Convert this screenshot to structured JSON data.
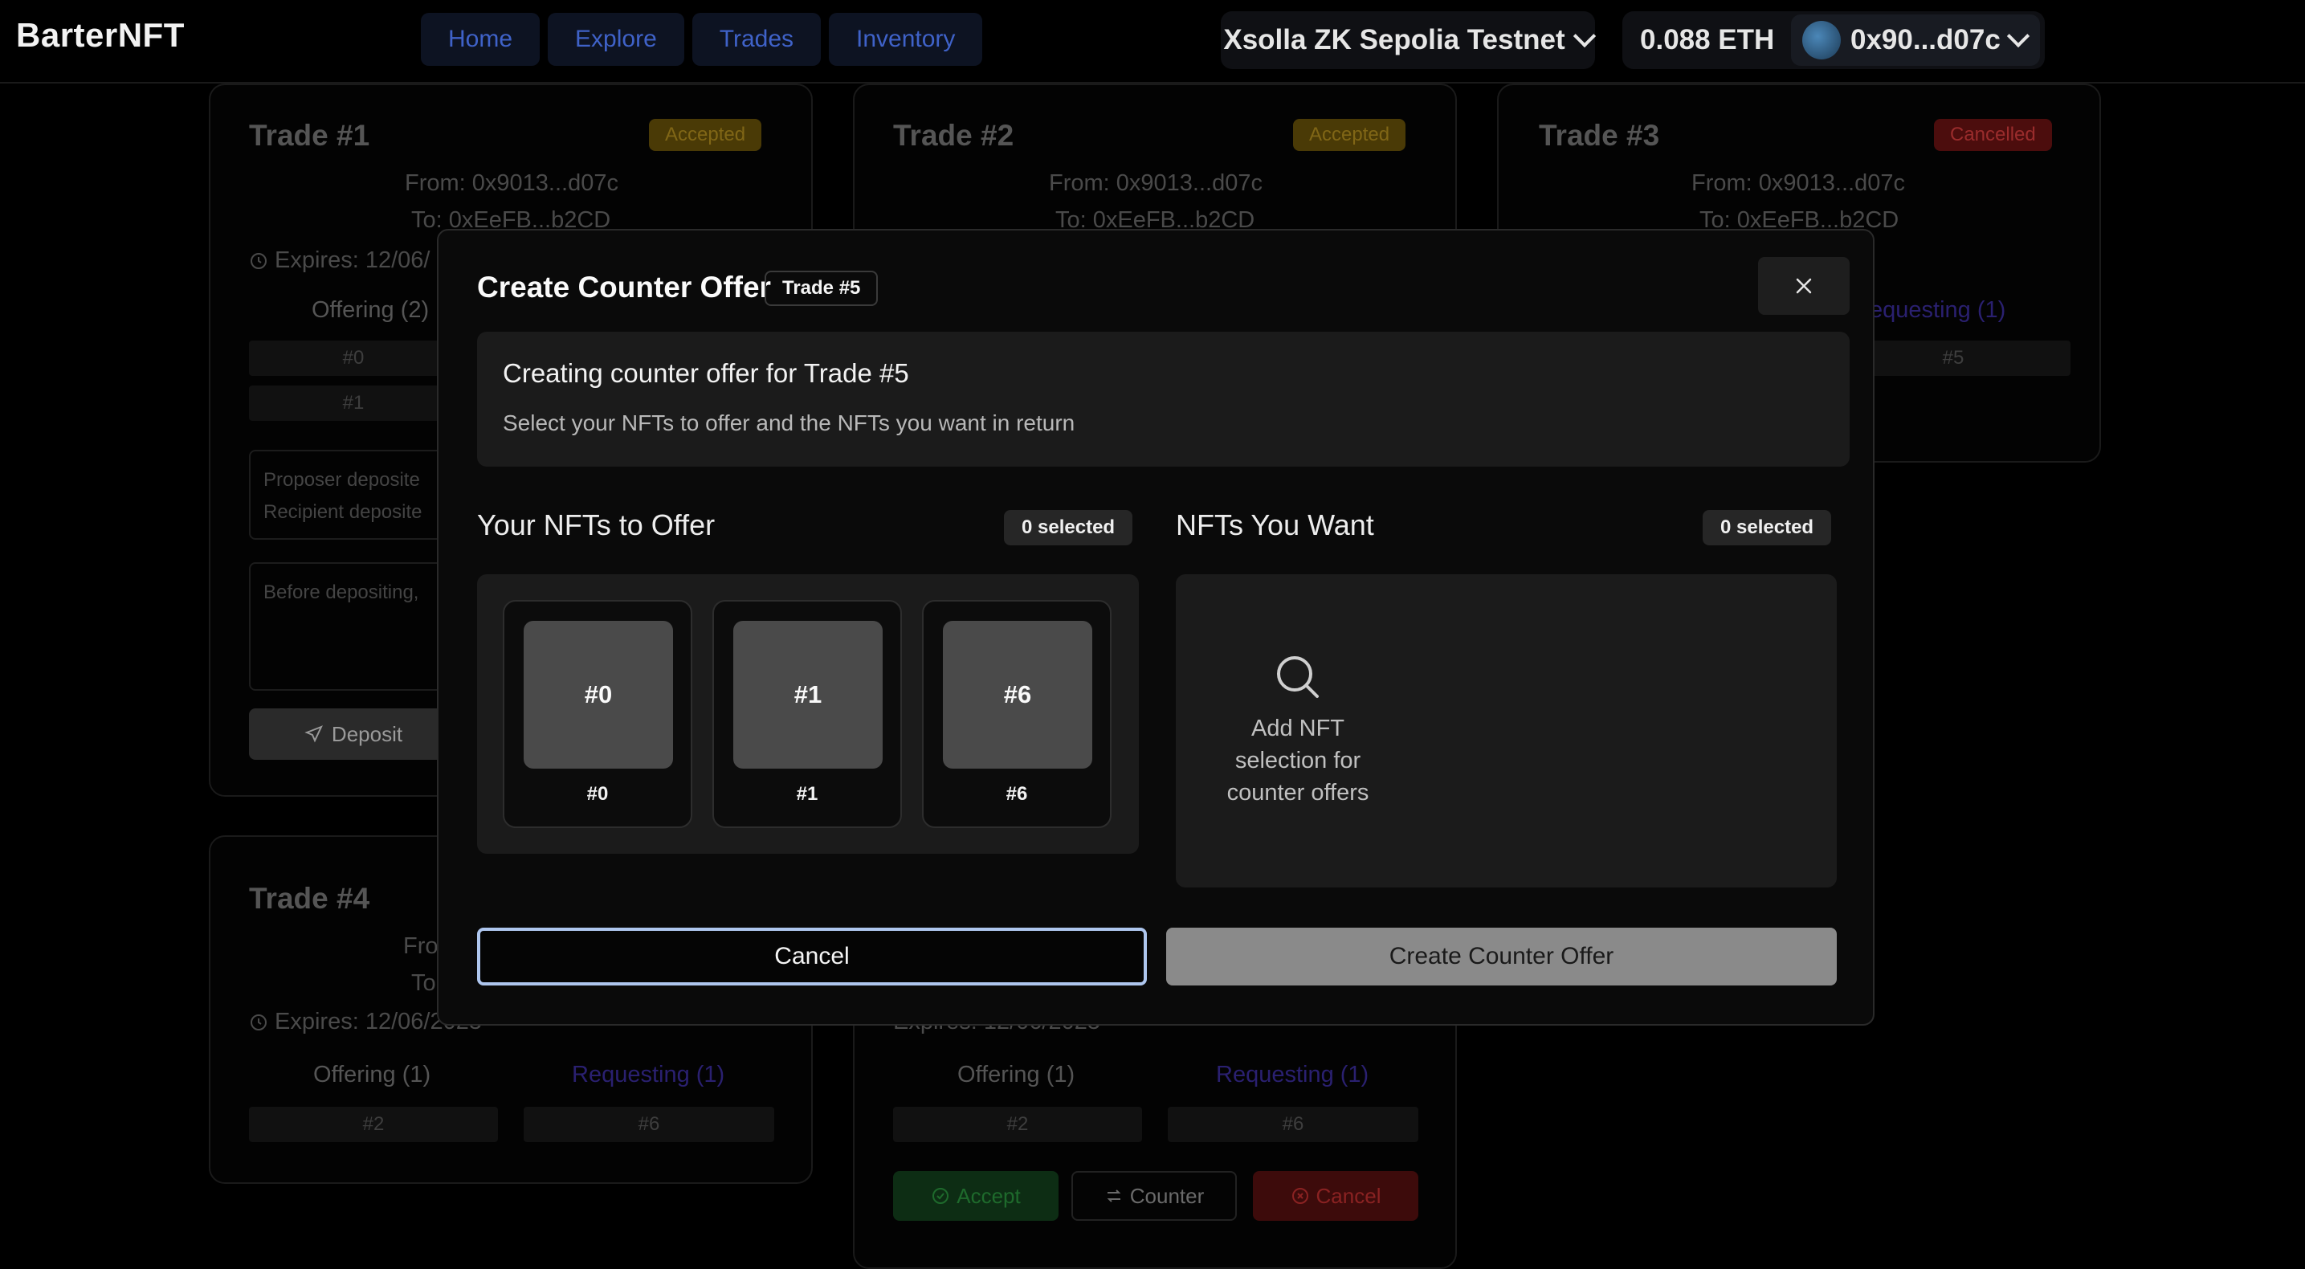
{
  "app": {
    "brand": "BarterNFT"
  },
  "nav": {
    "items": [
      {
        "label": "Home"
      },
      {
        "label": "Explore"
      },
      {
        "label": "Trades"
      },
      {
        "label": "Inventory"
      }
    ]
  },
  "wallet": {
    "network": "Xsolla ZK Sepolia Testnet",
    "balance": "0.088 ETH",
    "address": "0x90...d07c"
  },
  "trades": [
    {
      "title": "Trade #1",
      "status": "Accepted",
      "from": "From: 0x9013...d07c",
      "to": "To: 0xEeFB...b2CD",
      "expires": "Expires: 12/06/",
      "offering": "Offering (2)",
      "offer_items": [
        "#0",
        "#1"
      ],
      "deposit_line1": "Proposer deposite",
      "deposit_line2": "Recipient deposite",
      "before_text": "Before depositing,",
      "deposit_btn": "Deposit"
    },
    {
      "title": "Trade #2",
      "status": "Accepted",
      "from": "From: 0x9013...d07c",
      "to": "To: 0xEeFB...b2CD"
    },
    {
      "title": "Trade #3",
      "status": "Cancelled",
      "from": "From: 0x9013...d07c",
      "to": "To: 0xEeFB...b2CD",
      "requesting": "equesting (1)",
      "request_items": [
        "#5"
      ]
    },
    {
      "title": "Trade #4",
      "from": "Fro",
      "to": "To",
      "expires": "Expires: 12/06/2025",
      "offering": "Offering (1)",
      "requesting": "Requesting (1)",
      "offer_items": [
        "#2"
      ],
      "request_items": [
        "#6"
      ]
    },
    {
      "expires": "Expires: 12/06/2025",
      "offering": "Offering (1)",
      "requesting": "Requesting (1)",
      "offer_items": [
        "#2"
      ],
      "request_items": [
        "#6"
      ],
      "accept_btn": "Accept",
      "counter_btn": "Counter",
      "cancel_btn": "Cancel"
    }
  ],
  "modal": {
    "title": "Create Counter Offer",
    "trade_badge": "Trade #5",
    "info_title": "Creating counter offer for Trade #5",
    "info_desc": "Select your NFTs to offer and the NFTs you want in return",
    "offer": {
      "title": "Your NFTs to Offer",
      "selected": "0 selected",
      "nfts": [
        {
          "thumb": "#0",
          "label": "#0"
        },
        {
          "thumb": "#1",
          "label": "#1"
        },
        {
          "thumb": "#6",
          "label": "#6"
        }
      ]
    },
    "want": {
      "title": "NFTs You Want",
      "selected": "0 selected",
      "add_text": "Add NFT selection for counter offers"
    },
    "cancel_label": "Cancel",
    "create_label": "Create Counter Offer"
  },
  "icons": {
    "close": "close-icon",
    "search": "search-icon",
    "clock": "clock-icon",
    "chevron": "chevron-down-icon"
  }
}
